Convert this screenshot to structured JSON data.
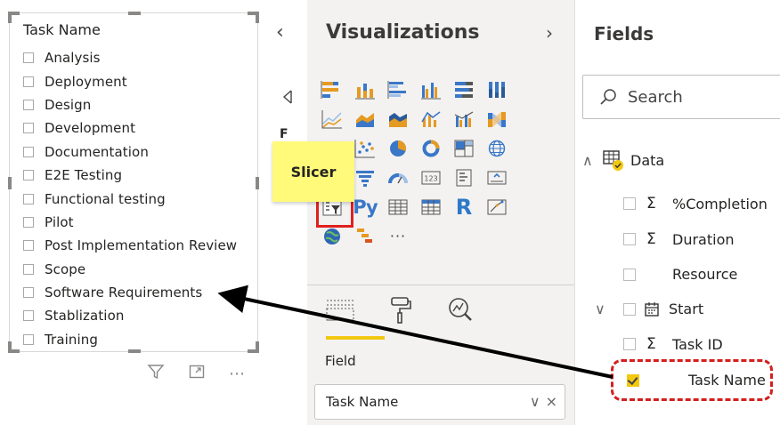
{
  "slicer": {
    "title": "Task Name",
    "items": [
      "Analysis",
      "Deployment",
      "Design",
      "Development",
      "Documentation",
      "E2E Testing",
      "Functional testing",
      "Pilot",
      "Post Implementation Review",
      "Scope",
      "Software Requirements",
      "Stablization",
      "Training"
    ],
    "toolbar_more": "⋯"
  },
  "collapse": {
    "chevron": "‹",
    "filters_label": "F"
  },
  "visualizations": {
    "title": "Visualizations",
    "expand_chevron": "›",
    "tooltip": "Slicer",
    "py_label": "Py",
    "r_label": "R",
    "more_label": "···",
    "field_label": "Field",
    "field_well_value": "Task Name",
    "well_chevron": "∨",
    "well_close": "×"
  },
  "fields": {
    "title": "Fields",
    "search_placeholder": "Search",
    "table_name": "Data",
    "expand_glyph": "∧",
    "collapse_glyph": "∨",
    "sigma": "Σ",
    "items": {
      "completion": "%Completion",
      "duration": "Duration",
      "resource": "Resource",
      "start": "Start",
      "task_id": "Task ID",
      "task_name": "Task Name"
    }
  },
  "colors": {
    "accent_yellow": "#f2c811",
    "highlight_red": "#d41e1e",
    "pane_gray": "#f3f2f1"
  }
}
